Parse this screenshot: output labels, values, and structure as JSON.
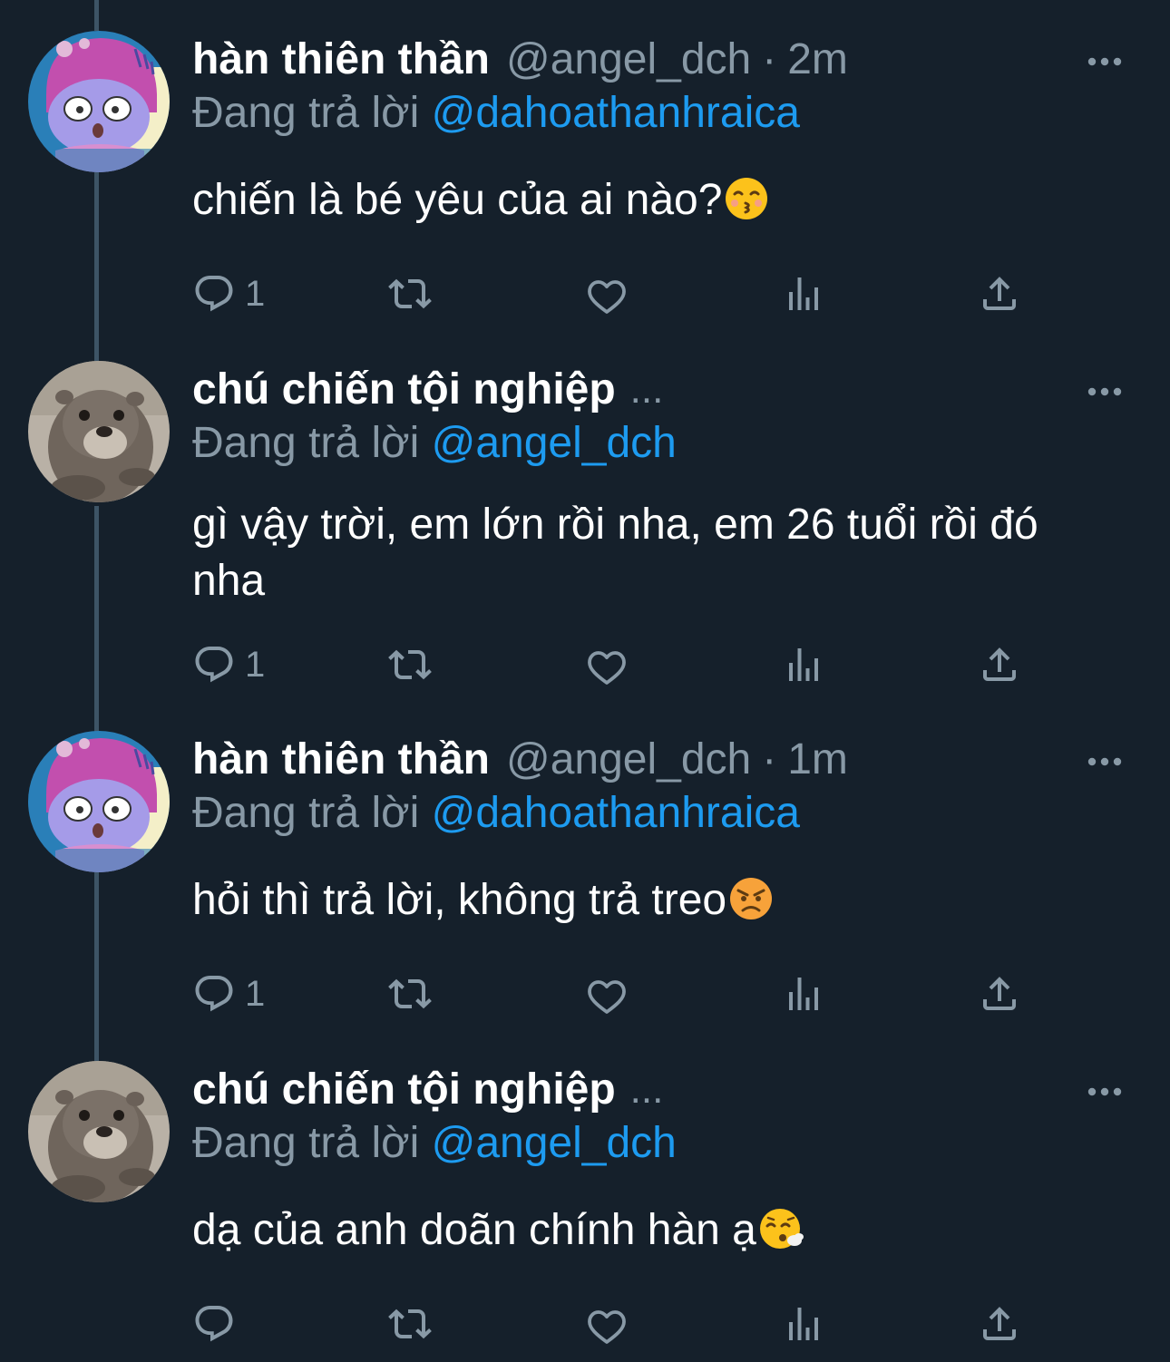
{
  "tweets": [
    {
      "name": "hàn thiên thần",
      "handle": "@angel_dch",
      "separator": "·",
      "time": "2m",
      "reply_prefix": "Đang trả lời",
      "reply_to": "@dahoathanhraica",
      "text": "chiến là bé yêu của ai nào?",
      "emoji": "kissing-face-closed-eyes-emoji",
      "reply_count": "1",
      "avatar": "cartoon-character-avatar"
    },
    {
      "name": "chú chiến tội nghiệp",
      "ellipsis": "...",
      "reply_prefix": "Đang trả lời",
      "reply_to": "@angel_dch",
      "text": "gì vậy trời, em lớn rồi nha, em 26 tuổi rồi đó nha",
      "reply_count": "1",
      "avatar": "otter-avatar"
    },
    {
      "name": "hàn thiên thần",
      "handle": "@angel_dch",
      "separator": "·",
      "time": "1m",
      "reply_prefix": "Đang trả lời",
      "reply_to": "@dahoathanhraica",
      "text": "hỏi thì trả lời, không trả treo",
      "emoji": "angry-face-emoji",
      "reply_count": "1",
      "avatar": "cartoon-character-avatar"
    },
    {
      "name": "chú chiến tội nghiệp",
      "ellipsis": "...",
      "reply_prefix": "Đang trả lời",
      "reply_to": "@angel_dch",
      "text": "dạ của anh doãn chính hàn ạ",
      "emoji": "face-exhaling-emoji",
      "reply_count": "",
      "avatar": "otter-avatar"
    }
  ],
  "icons": [
    "reply-icon",
    "retweet-icon",
    "like-icon",
    "views-icon",
    "share-icon",
    "more-icon"
  ],
  "colors": {
    "background": "#15202b",
    "text": "#ffffff",
    "secondary": "#8899a6",
    "mention": "#1d9bf0",
    "thread_line": "#3d5466"
  }
}
